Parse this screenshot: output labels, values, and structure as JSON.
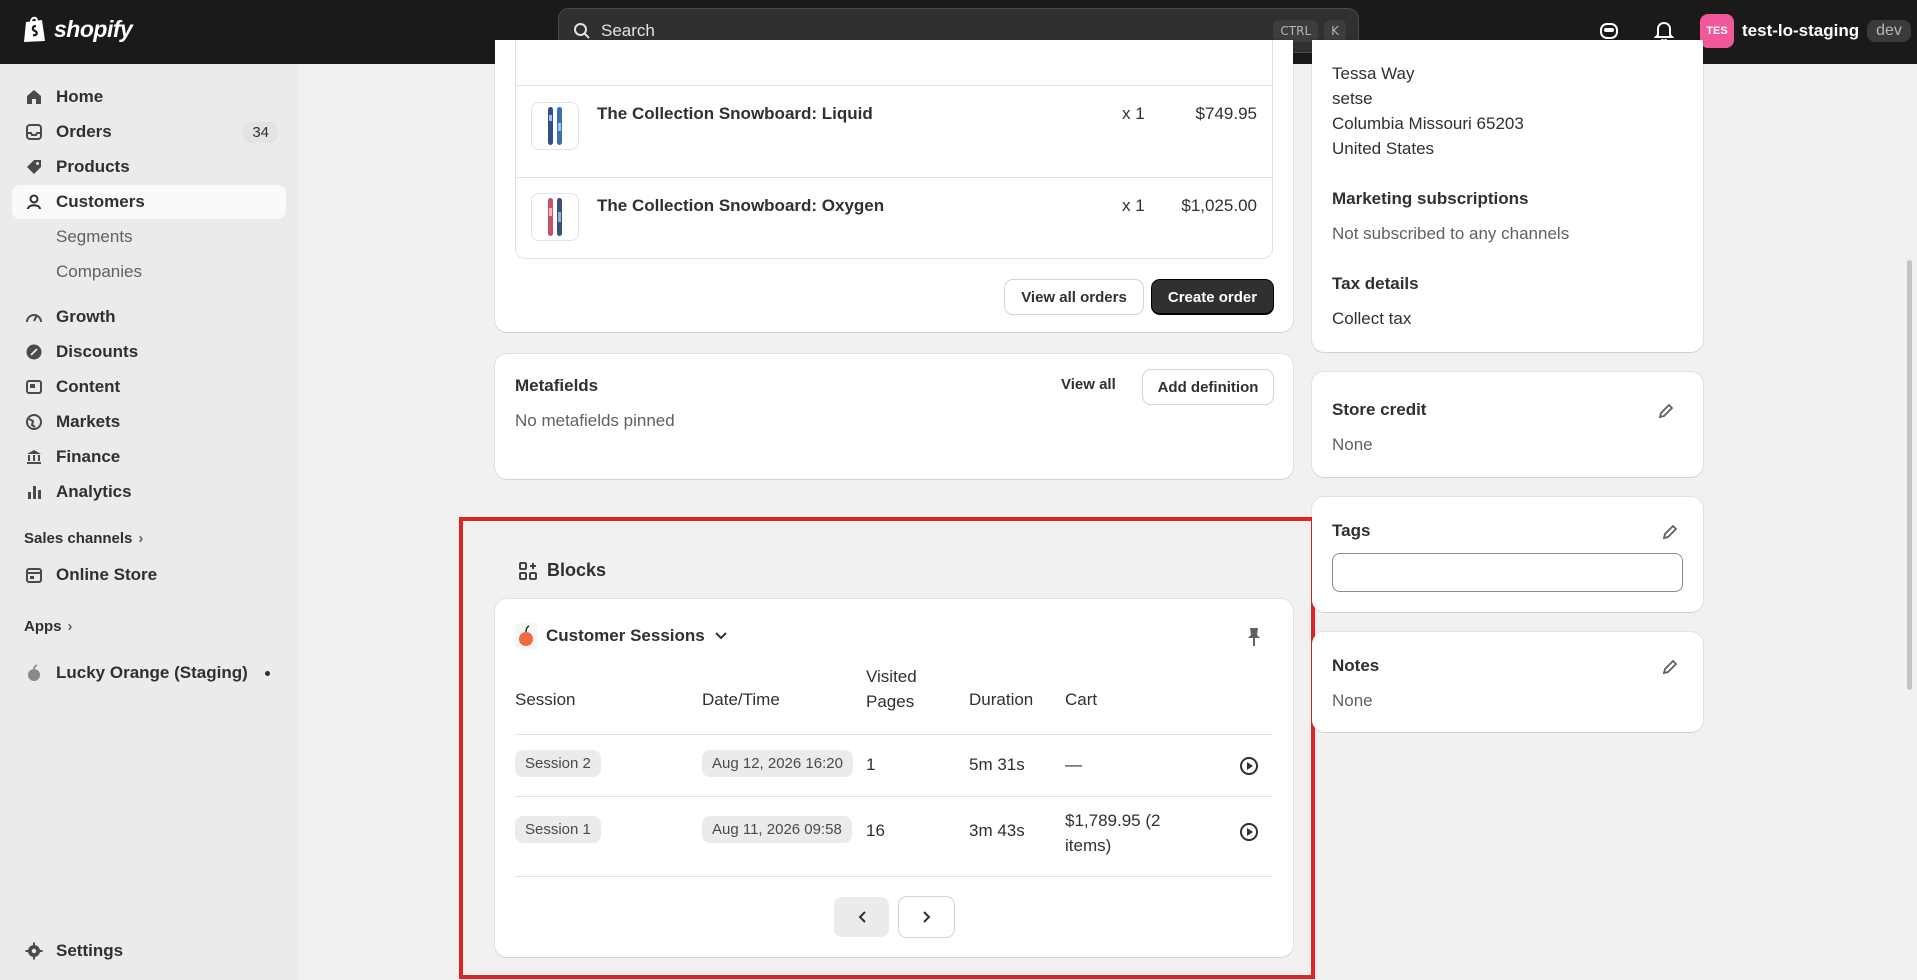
{
  "topbar": {
    "brand": "shopify",
    "search_placeholder": "Search",
    "shortcut_ctrl": "CTRL",
    "shortcut_k": "K",
    "avatar_initials": "TES",
    "store_name": "test-lo-staging",
    "env_badge": "dev"
  },
  "sidebar": {
    "home": "Home",
    "orders": "Orders",
    "orders_count": "34",
    "products": "Products",
    "customers": "Customers",
    "segments": "Segments",
    "companies": "Companies",
    "growth": "Growth",
    "discounts": "Discounts",
    "content": "Content",
    "markets": "Markets",
    "finance": "Finance",
    "analytics": "Analytics",
    "sales_channels": "Sales channels",
    "online_store": "Online Store",
    "apps": "Apps",
    "lucky_orange": "Lucky Orange (Staging)",
    "settings": "Settings"
  },
  "orders_card": {
    "items": [
      {
        "name": "The Collection Snowboard: Liquid",
        "qty": "x 1",
        "price": "$749.95"
      },
      {
        "name": "The Collection Snowboard: Oxygen",
        "qty": "x 1",
        "price": "$1,025.00"
      }
    ],
    "view_all_orders": "View all orders",
    "create_order": "Create order"
  },
  "metafields": {
    "title": "Metafields",
    "view_all": "View all",
    "add_definition": "Add definition",
    "empty": "No metafields pinned"
  },
  "blocks": {
    "title": "Blocks",
    "app_title": "Customer Sessions",
    "columns": {
      "session": "Session",
      "datetime": "Date/Time",
      "visited": "Visited Pages",
      "duration": "Duration",
      "cart": "Cart"
    },
    "rows": [
      {
        "session": "Session 2",
        "datetime": "Aug 12, 2026 16:20",
        "visited": "1",
        "duration": "5m 31s",
        "cart": "—"
      },
      {
        "session": "Session 1",
        "datetime": "Aug 11, 2026 09:58",
        "visited": "16",
        "duration": "3m 43s",
        "cart": "$1,789.95 (2 items)"
      }
    ]
  },
  "address_card": {
    "lines": [
      "Tessa Way",
      "setse",
      "Columbia Missouri 65203",
      "United States"
    ],
    "marketing_title": "Marketing subscriptions",
    "marketing_value": "Not subscribed to any channels",
    "tax_title": "Tax details",
    "tax_value": "Collect tax"
  },
  "store_credit": {
    "title": "Store credit",
    "value": "None"
  },
  "tags": {
    "title": "Tags",
    "value": ""
  },
  "notes": {
    "title": "Notes",
    "value": "None"
  }
}
